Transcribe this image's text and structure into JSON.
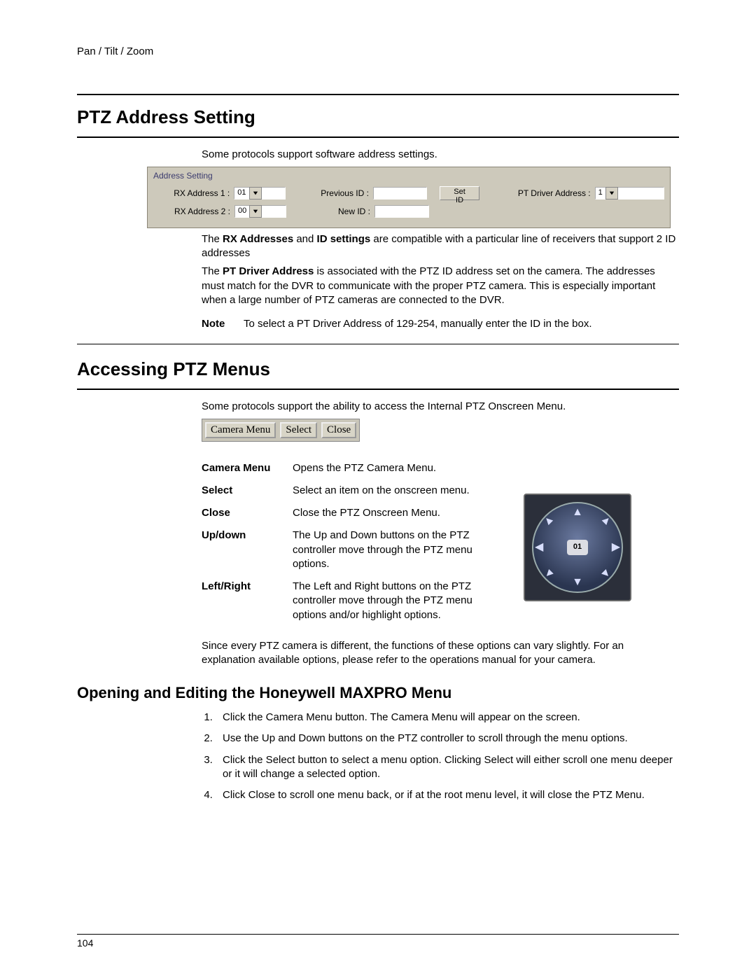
{
  "breadcrumb": "Pan / Tilt / Zoom",
  "page_number": "104",
  "section1": {
    "heading": "PTZ Address Setting",
    "intro": "Some protocols support software address settings.",
    "fieldset": {
      "legend": "Address Setting",
      "rx1_label": "RX Address 1 :",
      "rx1_value": "01",
      "rx2_label": "RX Address 2 :",
      "rx2_value": "00",
      "prev_id_label": "Previous ID :",
      "new_id_label": "New ID :",
      "set_id_btn": "Set ID",
      "pt_label": "PT Driver Address  :",
      "pt_value": "1"
    },
    "para1_pre": "The ",
    "para1_b1": "RX Addresses",
    "para1_mid": " and ",
    "para1_b2": "ID settings",
    "para1_post": " are compatible with a particular line of receivers that support 2 ID addresses",
    "para2_pre": "The ",
    "para2_b": "PT Driver Address",
    "para2_post": " is associated with the PTZ ID address set on the camera.   The addresses must match for the DVR to communicate with the proper PTZ camera.  This is especially important when a large number of PTZ cameras are connected to the DVR.",
    "note_label": "Note",
    "note_text": "To select a PT Driver Address of 129-254, manually enter the ID in the box."
  },
  "section2": {
    "heading": "Accessing PTZ Menus",
    "intro": "Some protocols support the ability to access the Internal PTZ Onscreen Menu.",
    "buttons": {
      "camera": "Camera Menu",
      "select": "Select",
      "close": "Close"
    },
    "defs": [
      {
        "term": "Camera Menu",
        "desc": "Opens the PTZ Camera Menu."
      },
      {
        "term": "Select",
        "desc": "Select an item on the onscreen menu."
      },
      {
        "term": "Close",
        "desc": "Close the PTZ Onscreen Menu."
      },
      {
        "term": "Up/down",
        "desc": "The Up and Down buttons on the PTZ controller move through the PTZ menu options."
      },
      {
        "term": "Left/Right",
        "desc": "The Left and Right buttons on the PTZ controller move through the PTZ menu options and/or highlight options."
      }
    ],
    "compass_hub": "01",
    "footnote": "Since every PTZ camera is different, the functions of these options can vary slightly. For an explanation available options, please refer to the operations manual for your camera."
  },
  "section3": {
    "heading": "Opening and Editing the Honeywell MAXPRO Menu",
    "steps": [
      "Click the Camera Menu button. The Camera Menu will appear on the screen.",
      "Use the Up and Down buttons on the PTZ controller to scroll through the menu options.",
      "Click the Select button to select a menu option.   Clicking Select will either scroll one menu deeper or it will change a selected option.",
      "Click Close to scroll one menu back, or if at the root menu level, it will close the PTZ Menu."
    ]
  }
}
